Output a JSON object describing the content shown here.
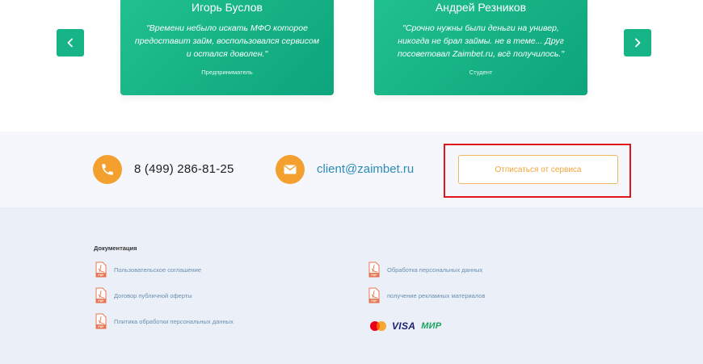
{
  "testimonials": [
    {
      "name": "Игорь Буслов",
      "quote": "\"Времени небыло искать МФО которое предоставит займ, воспользовался сервисом и остался доволен.\"",
      "role": "Предприниматель"
    },
    {
      "name": "Андрей Резников",
      "quote": "\"Срочно нужны были деньги на универ, никогда не брал займы. не в теме... Друг посоветовал Zaimbet.ru, всё получилось.\"",
      "role": "Студент"
    }
  ],
  "contacts": {
    "phone": "8 (499) 286-81-25",
    "email": "client@zaimbet.ru",
    "unsubscribe_label": "Отписаться от сервиса"
  },
  "footer": {
    "docs_title": "Документация",
    "docs": [
      "Пользовательское соглашение",
      "Договор публичной оферты",
      "Плитика обработки персональных данных",
      "Обработка персональных данных",
      "получение рекламных материалов"
    ],
    "payments": {
      "visa": "VISA",
      "mir": "МИР"
    }
  },
  "colors": {
    "card_green": "#17b488",
    "accent_orange": "#f3a02e",
    "email_blue": "#2d8bb5",
    "highlight_red": "#e0141b"
  }
}
